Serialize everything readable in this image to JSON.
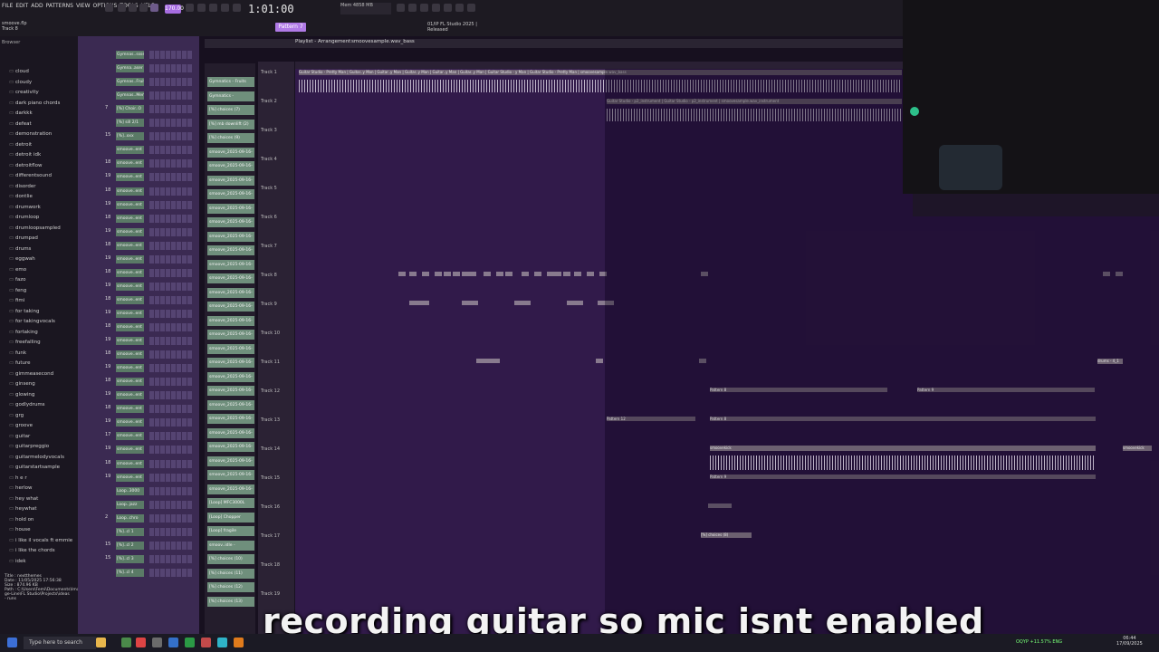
{
  "menu": [
    "FILE",
    "EDIT",
    "ADD",
    "PATTERNS",
    "VIEW",
    "OPTIONS",
    "TOOLS",
    "HELP"
  ],
  "transport": {
    "tempo": "170.00",
    "time": "1:01:00",
    "cpu_label": "Mem",
    "cpu_value": "4858 MB"
  },
  "project": {
    "file": "smoove.flp",
    "track": "Track 8"
  },
  "hint": {
    "line1": "01/IP  FL Studio 2025 |",
    "line2": "Released"
  },
  "pattern_selector": "Pattern 7",
  "playlist": {
    "title": "Playlist - Arrangement",
    "breadcrumb": "smoovesample.wav_bass"
  },
  "browser": {
    "header": "Browser",
    "folders": [
      "cloud",
      "cloudy",
      "creativity",
      "dark piano chords",
      "darkkk",
      "defeat",
      "demonstration",
      "detroit",
      "detroit idk",
      "detroitflow",
      "differentsound",
      "disorder",
      "dontlie",
      "drumwork",
      "drumloop",
      "drumloopsampled",
      "drumpad",
      "drums",
      "eggwah",
      "emo",
      "fazo",
      "feng",
      "fimi",
      "for taking",
      "for takingvocals",
      "fortaking",
      "freefalling",
      "funk",
      "future",
      "gimmeasecond",
      "ginseng",
      "glowing",
      "godlydrums",
      "grg",
      "groove",
      "guitar",
      "guitarpreggio",
      "guitarmelodyvocals",
      "guitarstartsample",
      "h e r",
      "herlow",
      "hey what",
      "heywhat",
      "hold on",
      "house",
      "i like il vocals ft emmie",
      "i like the chords",
      "idek"
    ],
    "fileinfo": [
      "Title : nextthemes",
      "Date : 11/05/2025 17:56:38",
      "Size : 874.96 KB",
      "Path : C:\\Users\\Femi\\Documents\\Ima",
      "ge-Line\\FL Studio\\Projects\\ideas",
      "- runs"
    ]
  },
  "rack": [
    {
      "num": "",
      "name": "Gymnas..ssss 2"
    },
    {
      "num": "",
      "name": "Gymna..aser"
    },
    {
      "num": "",
      "name": "Gymnas..Fruits"
    },
    {
      "num": "",
      "name": "Gymnas..Mem"
    },
    {
      "num": "7",
      "name": "[%] Choir..O"
    },
    {
      "num": "",
      "name": "[%] sill 2/1"
    },
    {
      "num": "15",
      "name": "[%]..xxx"
    },
    {
      "num": "",
      "name": "smoove..ent 19"
    },
    {
      "num": "18",
      "name": "smoove..ent 19"
    },
    {
      "num": "19",
      "name": "smoove..ent 19"
    },
    {
      "num": "18",
      "name": "smoove..ent 19"
    },
    {
      "num": "19",
      "name": "smoove..ent 19"
    },
    {
      "num": "18",
      "name": "smoove..ent 19"
    },
    {
      "num": "19",
      "name": "smoove..ent 19"
    },
    {
      "num": "18",
      "name": "smoove..ent 19"
    },
    {
      "num": "19",
      "name": "smoove..ent 19"
    },
    {
      "num": "18",
      "name": "smoove..ent 19"
    },
    {
      "num": "19",
      "name": "smoove..ent 19"
    },
    {
      "num": "18",
      "name": "smoove..ent 19"
    },
    {
      "num": "19",
      "name": "smoove..ent 19"
    },
    {
      "num": "18",
      "name": "smoove..ent 19"
    },
    {
      "num": "19",
      "name": "smoove..ent 19"
    },
    {
      "num": "18",
      "name": "smoove..ent 19"
    },
    {
      "num": "19",
      "name": "smoove..ent 19"
    },
    {
      "num": "18",
      "name": "smoove..ent 19"
    },
    {
      "num": "19",
      "name": "smoove..ent 19"
    },
    {
      "num": "18",
      "name": "smoove..ent 19"
    },
    {
      "num": "19",
      "name": "smoove..ent 19"
    },
    {
      "num": "17",
      "name": "smoove..ent 19"
    },
    {
      "num": "19",
      "name": "smoove..ent 19"
    },
    {
      "num": "18",
      "name": "smoove..ent 19"
    },
    {
      "num": "19",
      "name": "smoove..ent 19"
    },
    {
      "num": "",
      "name": "Loop..3000"
    },
    {
      "num": "",
      "name": "Loop..jazz"
    },
    {
      "num": "2",
      "name": "Loop..chro"
    },
    {
      "num": "",
      "name": "[%]..cl 1"
    },
    {
      "num": "15",
      "name": "[%]..cl 2"
    },
    {
      "num": "15",
      "name": "[%]..cl 3"
    },
    {
      "num": "",
      "name": "[%]..cl 4"
    }
  ],
  "mixer": [
    "Gymnatics - Fruits Dru..",
    "Gymnatics - Memories",
    "[%] choices (7)",
    "[%] mb downlift (2)",
    "[%] choices (9)",
    "smoove_2025-09-16-09-..",
    "smoove_2025-09-16-09-..",
    "smoove_2025-09-16-09-..",
    "smoove_2025-09-16-09-..",
    "smoove_2025-09-16-09-..",
    "smoove_2025-09-16-09-..",
    "smoove_2025-09-16-09-..",
    "smoove_2025-09-16-09-..",
    "smoove_2025-09-16-09-..",
    "smoove_2025-09-16-09-..",
    "smoove_2025-09-16-10-..",
    "smoove_2025-09-16-10-..",
    "smoove_2025-09-16-10-..",
    "smoove_2025-09-16-10-..",
    "smoove_2025-09-16-10-..",
    "smoove_2025-09-16-10-..",
    "smoove_2025-09-16-10-..",
    "smoove_2025-09-16-10-..",
    "smoove_2025-09-16-10-..",
    "smoove_2025-09-16-10-..",
    "smoove_2025-09-16-10-..",
    "smoove_2025-09-16-10-..",
    "smoove_2025-09-16-10-..",
    "smoove_2025-09-16-10-..",
    "smoove_2025-09-16-10-..",
    "[Loop] MFC3000L",
    "[Loop] Chopper",
    "[Loop] fragile",
    "smoov..idle - (Repeat)..",
    "[%] choices (10)",
    "[%] choices (11)",
    "[%] choices (12)",
    "[%] choices (13)"
  ],
  "tracks": [
    "Track 1",
    "Track 2",
    "Track 3",
    "Track 4",
    "Track 5",
    "Track 6",
    "Track 7",
    "Track 8",
    "Track 9",
    "Track 10",
    "Track 11",
    "Track 12",
    "Track 13",
    "Track 14",
    "Track 15",
    "Track 16",
    "Track 17",
    "Track 18",
    "Track 19"
  ],
  "clips": {
    "track1_header": "Guitar Studio - Pretty Man  | Guitar..y Man | Guitar..y Man | Guitar..y Man | Guitar..y Man | Guitar..y Man | Guitar Studio - y Man | Guitar Studio - Pretty Man | smoovesample.wav_bass",
    "track2_header": "Guitar Studio - p2_instrument | Guitar Studio - p2_instrument | smoovesample.wav_instrument",
    "pattern_label": "Pattern 8",
    "pattern_label_b": "Pattern 9",
    "pattern_label_c": "Pattern 12",
    "smoove_label": "smoovekick",
    "drum_label": "drums - 4_1",
    "choices_label": "[%] choices (8)"
  },
  "caption": "recording guitar so mic isnt enabled",
  "taskbar": {
    "search_placeholder": "Type here to search",
    "tray": "OQYP  +11.57%  ENG",
    "time": "06:44",
    "date": "17/09/2025"
  },
  "colors": {
    "accent": "#a66ce0",
    "arrange_bg": "#311a4a",
    "clip": "#6c6070"
  }
}
